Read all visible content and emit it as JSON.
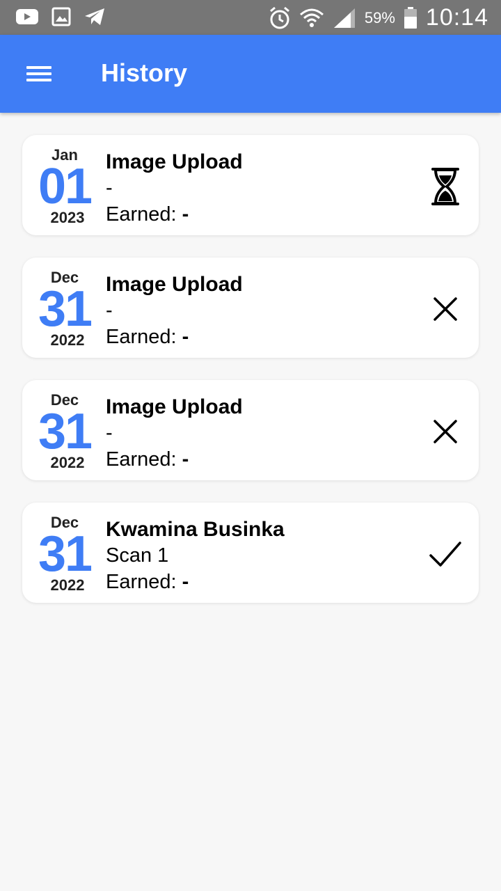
{
  "status_bar": {
    "icons_left": [
      "youtube-icon",
      "gallery-icon",
      "telegram-icon"
    ],
    "icons_right": [
      "alarm-icon",
      "wifi-icon",
      "signal-icon"
    ],
    "battery_percent": "59%",
    "time": "10:14"
  },
  "app_bar": {
    "menu_icon": "hamburger-menu-icon",
    "title": "History"
  },
  "colors": {
    "primary": "#3f7df5",
    "status_bar": "#767676",
    "background": "#f7f7f7"
  },
  "history": [
    {
      "month": "Jan",
      "day": "01",
      "year": "2023",
      "title": "Image Upload",
      "subtitle": "-",
      "earned_label": "Earned: ",
      "earned_value": "-",
      "status": "pending",
      "status_icon": "hourglass-icon"
    },
    {
      "month": "Dec",
      "day": "31",
      "year": "2022",
      "title": "Image Upload",
      "subtitle": "-",
      "earned_label": "Earned: ",
      "earned_value": "-",
      "status": "rejected",
      "status_icon": "close-icon"
    },
    {
      "month": "Dec",
      "day": "31",
      "year": "2022",
      "title": "Image Upload",
      "subtitle": "-",
      "earned_label": "Earned: ",
      "earned_value": "-",
      "status": "rejected",
      "status_icon": "close-icon"
    },
    {
      "month": "Dec",
      "day": "31",
      "year": "2022",
      "title": "Kwamina Businka",
      "subtitle": "Scan 1",
      "earned_label": "Earned: ",
      "earned_value": "-",
      "status": "approved",
      "status_icon": "check-icon"
    }
  ]
}
